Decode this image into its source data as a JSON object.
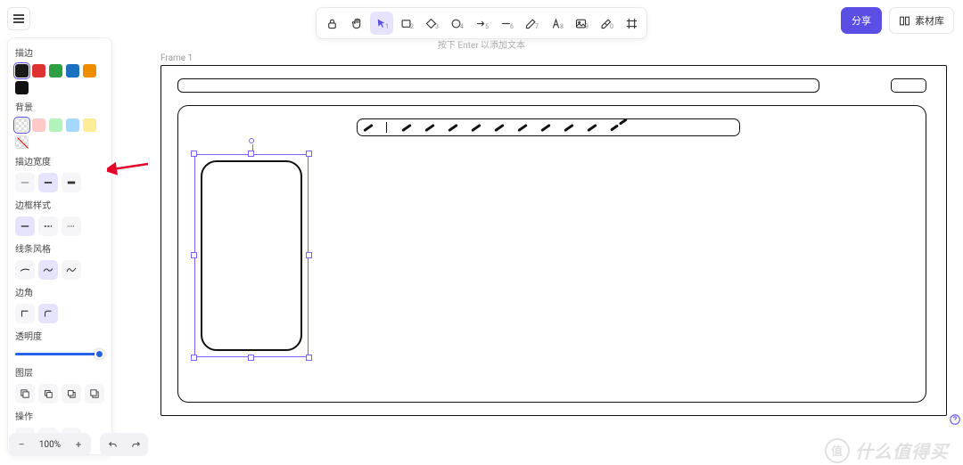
{
  "topbar": {
    "share_label": "分享",
    "library_label": "素材库",
    "hint": "按下 Enter 以添加文本"
  },
  "tools": {
    "items": [
      {
        "name": "lock-icon",
        "glyph": "lock"
      },
      {
        "name": "hand-icon",
        "glyph": "hand"
      },
      {
        "name": "pointer-icon",
        "glyph": "pointer",
        "active": true,
        "sub": "1"
      },
      {
        "name": "square-icon",
        "glyph": "square",
        "sub": "2"
      },
      {
        "name": "diamond-icon",
        "glyph": "diamond",
        "sub": "3"
      },
      {
        "name": "circle-icon",
        "glyph": "circle",
        "sub": "4"
      },
      {
        "name": "arrow-icon",
        "glyph": "arrow",
        "sub": "5"
      },
      {
        "name": "line-icon",
        "glyph": "line",
        "sub": "6"
      },
      {
        "name": "pencil-icon",
        "glyph": "pencil",
        "sub": "7"
      },
      {
        "name": "text-icon",
        "glyph": "text",
        "sub": "8"
      },
      {
        "name": "image-icon",
        "glyph": "image",
        "sub": "9"
      },
      {
        "name": "eraser-icon",
        "glyph": "eraser",
        "sub": "0"
      },
      {
        "name": "frame-icon",
        "glyph": "frame"
      }
    ]
  },
  "sidebar": {
    "stroke_label": "描边",
    "stroke_colors": [
      "#1a1a1a",
      "#e03131",
      "#2f9e44",
      "#1971c2",
      "#f08c00",
      "#111111"
    ],
    "stroke_selected": 0,
    "bg_label": "背景",
    "bg_colors": [
      "transparent",
      "#ffc9c9",
      "#b2f2bb",
      "#a5d8ff",
      "#ffec99"
    ],
    "bg_selected": 0,
    "bg_has_transparent_toggle": true,
    "stroke_width_label": "描边宽度",
    "stroke_widths": [
      "thin",
      "medium",
      "thick"
    ],
    "stroke_width_selected": 1,
    "stroke_style_label": "边框样式",
    "stroke_styles": [
      "solid",
      "dashed",
      "dotted"
    ],
    "stroke_style_selected": 0,
    "sloppiness_label": "线条风格",
    "sloppiness": [
      "architect",
      "artist",
      "cartoonist"
    ],
    "sloppiness_selected": 1,
    "corners_label": "边角",
    "corners": [
      "sharp",
      "round"
    ],
    "corners_selected": 1,
    "opacity_label": "透明度",
    "opacity_value": 100,
    "layers_label": "图层",
    "layers": [
      "send-back",
      "send-backward",
      "bring-forward",
      "bring-front"
    ],
    "actions_label": "操作",
    "actions": [
      "duplicate",
      "delete",
      "link"
    ]
  },
  "canvas": {
    "frame_label": "Frame 1"
  },
  "footer": {
    "zoom_minus": "−",
    "zoom_level": "100%",
    "zoom_plus": "+"
  },
  "watermark": "什么值得买"
}
